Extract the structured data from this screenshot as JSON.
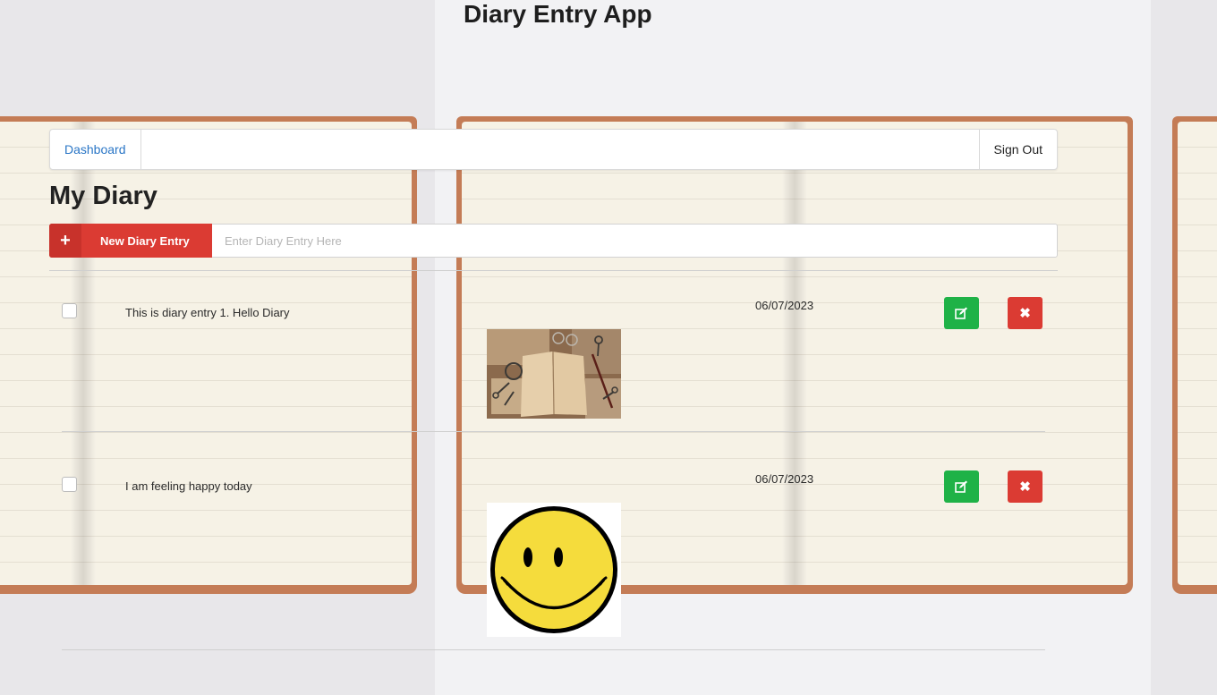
{
  "app": {
    "title": "Diary Entry App"
  },
  "navbar": {
    "dashboard_label": "Dashboard",
    "signout_label": "Sign Out"
  },
  "page": {
    "heading": "My Diary"
  },
  "new_entry": {
    "button_label": "New Diary Entry",
    "icon": "plus-icon",
    "input_value": "",
    "input_placeholder": "Enter Diary Entry Here"
  },
  "entries": [
    {
      "text": "This is diary entry 1. Hello Diary",
      "date": "06/07/2023",
      "checked": false,
      "image": "vintage-diary-keys-photo"
    },
    {
      "text": "I am feeling happy today",
      "date": "06/07/2023",
      "checked": false,
      "image": "smiley-face"
    }
  ],
  "actions": {
    "edit_icon": "edit-icon",
    "delete_icon": "close-icon",
    "delete_glyph": "✖"
  },
  "colors": {
    "danger": "#db3b33",
    "success": "#1fb247",
    "link": "#2a76c6",
    "smiley_yellow": "#f5dc3c"
  }
}
